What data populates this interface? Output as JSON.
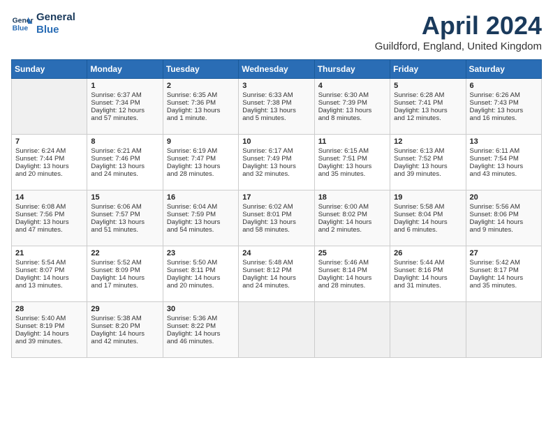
{
  "header": {
    "logo_line1": "General",
    "logo_line2": "Blue",
    "title": "April 2024",
    "location": "Guildford, England, United Kingdom"
  },
  "days_header": [
    "Sunday",
    "Monday",
    "Tuesday",
    "Wednesday",
    "Thursday",
    "Friday",
    "Saturday"
  ],
  "weeks": [
    [
      {
        "num": "",
        "content": ""
      },
      {
        "num": "1",
        "content": "Sunrise: 6:37 AM\nSunset: 7:34 PM\nDaylight: 12 hours\nand 57 minutes."
      },
      {
        "num": "2",
        "content": "Sunrise: 6:35 AM\nSunset: 7:36 PM\nDaylight: 13 hours\nand 1 minute."
      },
      {
        "num": "3",
        "content": "Sunrise: 6:33 AM\nSunset: 7:38 PM\nDaylight: 13 hours\nand 5 minutes."
      },
      {
        "num": "4",
        "content": "Sunrise: 6:30 AM\nSunset: 7:39 PM\nDaylight: 13 hours\nand 8 minutes."
      },
      {
        "num": "5",
        "content": "Sunrise: 6:28 AM\nSunset: 7:41 PM\nDaylight: 13 hours\nand 12 minutes."
      },
      {
        "num": "6",
        "content": "Sunrise: 6:26 AM\nSunset: 7:43 PM\nDaylight: 13 hours\nand 16 minutes."
      }
    ],
    [
      {
        "num": "7",
        "content": "Sunrise: 6:24 AM\nSunset: 7:44 PM\nDaylight: 13 hours\nand 20 minutes."
      },
      {
        "num": "8",
        "content": "Sunrise: 6:21 AM\nSunset: 7:46 PM\nDaylight: 13 hours\nand 24 minutes."
      },
      {
        "num": "9",
        "content": "Sunrise: 6:19 AM\nSunset: 7:47 PM\nDaylight: 13 hours\nand 28 minutes."
      },
      {
        "num": "10",
        "content": "Sunrise: 6:17 AM\nSunset: 7:49 PM\nDaylight: 13 hours\nand 32 minutes."
      },
      {
        "num": "11",
        "content": "Sunrise: 6:15 AM\nSunset: 7:51 PM\nDaylight: 13 hours\nand 35 minutes."
      },
      {
        "num": "12",
        "content": "Sunrise: 6:13 AM\nSunset: 7:52 PM\nDaylight: 13 hours\nand 39 minutes."
      },
      {
        "num": "13",
        "content": "Sunrise: 6:11 AM\nSunset: 7:54 PM\nDaylight: 13 hours\nand 43 minutes."
      }
    ],
    [
      {
        "num": "14",
        "content": "Sunrise: 6:08 AM\nSunset: 7:56 PM\nDaylight: 13 hours\nand 47 minutes."
      },
      {
        "num": "15",
        "content": "Sunrise: 6:06 AM\nSunset: 7:57 PM\nDaylight: 13 hours\nand 51 minutes."
      },
      {
        "num": "16",
        "content": "Sunrise: 6:04 AM\nSunset: 7:59 PM\nDaylight: 13 hours\nand 54 minutes."
      },
      {
        "num": "17",
        "content": "Sunrise: 6:02 AM\nSunset: 8:01 PM\nDaylight: 13 hours\nand 58 minutes."
      },
      {
        "num": "18",
        "content": "Sunrise: 6:00 AM\nSunset: 8:02 PM\nDaylight: 14 hours\nand 2 minutes."
      },
      {
        "num": "19",
        "content": "Sunrise: 5:58 AM\nSunset: 8:04 PM\nDaylight: 14 hours\nand 6 minutes."
      },
      {
        "num": "20",
        "content": "Sunrise: 5:56 AM\nSunset: 8:06 PM\nDaylight: 14 hours\nand 9 minutes."
      }
    ],
    [
      {
        "num": "21",
        "content": "Sunrise: 5:54 AM\nSunset: 8:07 PM\nDaylight: 14 hours\nand 13 minutes."
      },
      {
        "num": "22",
        "content": "Sunrise: 5:52 AM\nSunset: 8:09 PM\nDaylight: 14 hours\nand 17 minutes."
      },
      {
        "num": "23",
        "content": "Sunrise: 5:50 AM\nSunset: 8:11 PM\nDaylight: 14 hours\nand 20 minutes."
      },
      {
        "num": "24",
        "content": "Sunrise: 5:48 AM\nSunset: 8:12 PM\nDaylight: 14 hours\nand 24 minutes."
      },
      {
        "num": "25",
        "content": "Sunrise: 5:46 AM\nSunset: 8:14 PM\nDaylight: 14 hours\nand 28 minutes."
      },
      {
        "num": "26",
        "content": "Sunrise: 5:44 AM\nSunset: 8:16 PM\nDaylight: 14 hours\nand 31 minutes."
      },
      {
        "num": "27",
        "content": "Sunrise: 5:42 AM\nSunset: 8:17 PM\nDaylight: 14 hours\nand 35 minutes."
      }
    ],
    [
      {
        "num": "28",
        "content": "Sunrise: 5:40 AM\nSunset: 8:19 PM\nDaylight: 14 hours\nand 39 minutes."
      },
      {
        "num": "29",
        "content": "Sunrise: 5:38 AM\nSunset: 8:20 PM\nDaylight: 14 hours\nand 42 minutes."
      },
      {
        "num": "30",
        "content": "Sunrise: 5:36 AM\nSunset: 8:22 PM\nDaylight: 14 hours\nand 46 minutes."
      },
      {
        "num": "",
        "content": ""
      },
      {
        "num": "",
        "content": ""
      },
      {
        "num": "",
        "content": ""
      },
      {
        "num": "",
        "content": ""
      }
    ]
  ]
}
